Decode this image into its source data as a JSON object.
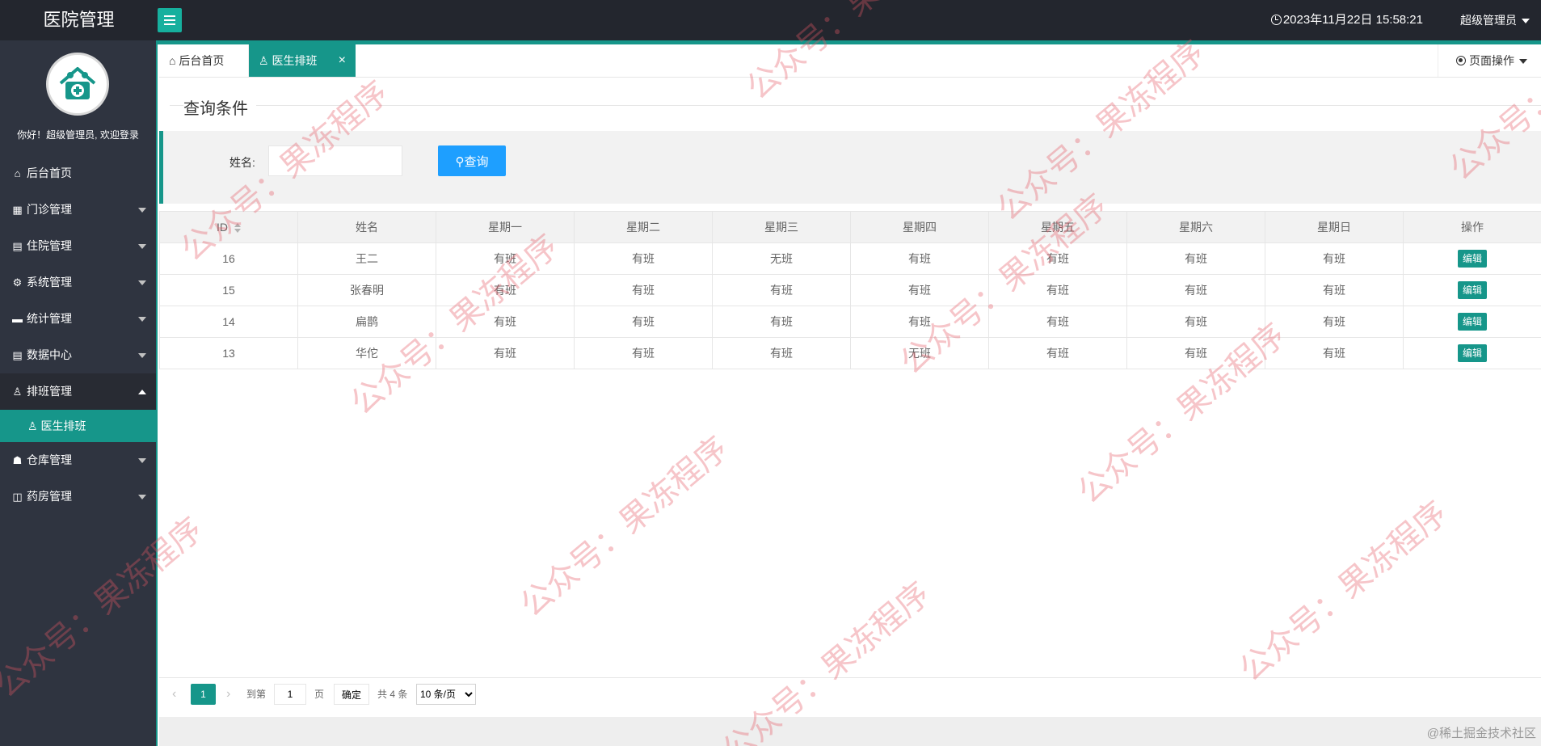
{
  "header": {
    "app_title": "医院管理",
    "datetime": "2023年11月22日 15:58:21",
    "user": "超级管理员"
  },
  "sidebar": {
    "welcome": "你好！超级管理员, 欢迎登录",
    "items": [
      {
        "label": "后台首页",
        "icon": "home-icon",
        "glyph": "⌂",
        "has_children": false
      },
      {
        "label": "门诊管理",
        "icon": "grid-icon",
        "glyph": "▦",
        "has_children": true
      },
      {
        "label": "住院管理",
        "icon": "building-icon",
        "glyph": "▤",
        "has_children": true
      },
      {
        "label": "系统管理",
        "icon": "gear-icon",
        "glyph": "⚙",
        "has_children": true
      },
      {
        "label": "统计管理",
        "icon": "monitor-icon",
        "glyph": "▬",
        "has_children": true
      },
      {
        "label": "数据中心",
        "icon": "document-icon",
        "glyph": "▤",
        "has_children": true
      },
      {
        "label": "排班管理",
        "icon": "user-icon",
        "glyph": "♙",
        "has_children": true,
        "open": true
      },
      {
        "label": "仓库管理",
        "icon": "cubes-icon",
        "glyph": "☗",
        "has_children": true
      },
      {
        "label": "药房管理",
        "icon": "book-icon",
        "glyph": "◫",
        "has_children": true
      }
    ],
    "active_sub": {
      "label": "医生排班",
      "icon": "user-icon",
      "glyph": "♙"
    }
  },
  "tabs": {
    "home": "后台首页",
    "active": "医生排班",
    "page_ops": "页面操作"
  },
  "search": {
    "section_title": "查询条件",
    "name_label": "姓名:",
    "name_value": "",
    "button": "查询"
  },
  "table": {
    "columns": [
      "ID",
      "姓名",
      "星期一",
      "星期二",
      "星期三",
      "星期四",
      "星期五",
      "星期六",
      "星期日",
      "操作"
    ],
    "rows": [
      [
        "16",
        "王二",
        "有班",
        "有班",
        "无班",
        "有班",
        "有班",
        "有班",
        "有班"
      ],
      [
        "15",
        "张春明",
        "有班",
        "有班",
        "有班",
        "有班",
        "有班",
        "有班",
        "有班"
      ],
      [
        "14",
        "扁鹊",
        "有班",
        "有班",
        "有班",
        "有班",
        "有班",
        "有班",
        "有班"
      ],
      [
        "13",
        "华佗",
        "有班",
        "有班",
        "有班",
        "无班",
        "有班",
        "有班",
        "有班"
      ]
    ],
    "action_label": "编辑"
  },
  "pager": {
    "current": "1",
    "goto_label": "到第",
    "page_input": "1",
    "page_unit": "页",
    "confirm": "确定",
    "total": "共 4 条",
    "page_size": "10 条/页",
    "page_size_options": [
      "10 条/页"
    ]
  },
  "watermark": {
    "text": "公众号：果冻程序"
  },
  "credit": "@稀土掘金技术社区",
  "colors": {
    "sidebar_bg": "#2f3440",
    "header_bg": "#23262e",
    "accent": "#16968a",
    "search_button": "#1e9fff"
  }
}
